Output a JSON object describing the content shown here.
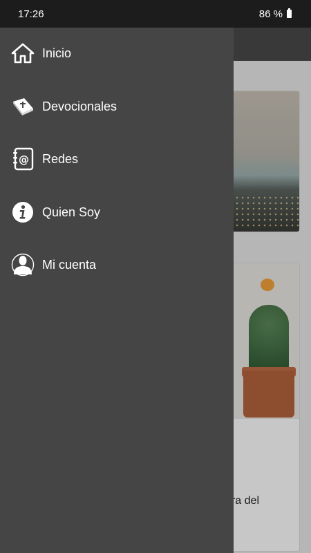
{
  "status_bar": {
    "time": "17:26",
    "battery": "86 %"
  },
  "background": {
    "card2_partial_text": "ra del"
  },
  "drawer": {
    "items": [
      {
        "label": "Inicio",
        "icon": "home-icon"
      },
      {
        "label": "Devocionales",
        "icon": "bible-icon"
      },
      {
        "label": "Redes",
        "icon": "address-book-at-icon"
      },
      {
        "label": "Quien Soy",
        "icon": "info-icon"
      },
      {
        "label": "Mi cuenta",
        "icon": "user-icon"
      }
    ]
  },
  "colors": {
    "drawer_bg": "#454545",
    "status_bar_bg": "#1c1c1c",
    "text": "#ffffff"
  }
}
